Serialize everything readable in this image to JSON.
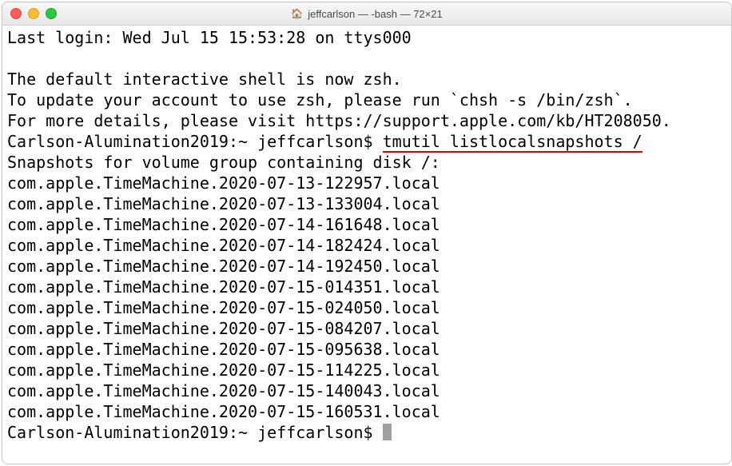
{
  "window": {
    "title": "jeffcarlson — -bash — 72×21"
  },
  "terminal": {
    "last_login": "Last login: Wed Jul 15 15:53:28 on ttys000",
    "msg1": "The default interactive shell is now zsh.",
    "msg2": "To update your account to use zsh, please run `chsh -s /bin/zsh`.",
    "msg3": "For more details, please visit https://support.apple.com/kb/HT208050.",
    "prompt1_host": "Carlson-Alumination2019:~ jeffcarlson$ ",
    "prompt1_cmd": "tmutil listlocalsnapshots /",
    "snapshot_header": "Snapshots for volume group containing disk /:",
    "snapshots": [
      "com.apple.TimeMachine.2020-07-13-122957.local",
      "com.apple.TimeMachine.2020-07-13-133004.local",
      "com.apple.TimeMachine.2020-07-14-161648.local",
      "com.apple.TimeMachine.2020-07-14-182424.local",
      "com.apple.TimeMachine.2020-07-14-192450.local",
      "com.apple.TimeMachine.2020-07-15-014351.local",
      "com.apple.TimeMachine.2020-07-15-024050.local",
      "com.apple.TimeMachine.2020-07-15-084207.local",
      "com.apple.TimeMachine.2020-07-15-095638.local",
      "com.apple.TimeMachine.2020-07-15-114225.local",
      "com.apple.TimeMachine.2020-07-15-140043.local",
      "com.apple.TimeMachine.2020-07-15-160531.local"
    ],
    "prompt2": "Carlson-Alumination2019:~ jeffcarlson$ "
  }
}
